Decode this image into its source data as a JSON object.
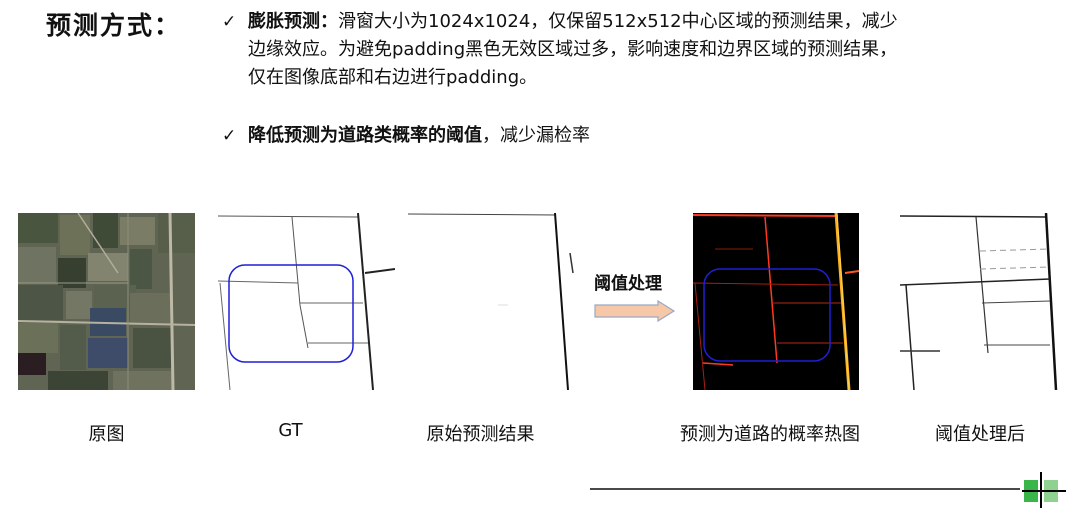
{
  "heading": "预测方式：",
  "bullets": [
    {
      "check": "✓",
      "bold": "膨胀预测：",
      "lines": [
        "滑窗大小为1024x1024，仅保留512x512中心区域的预测结果，减少",
        "边缘效应。为避免padding黑色无效区域过多，影响速度和边界区域的预测结果，",
        "仅在图像底部和右边进行padding。"
      ]
    },
    {
      "check": "✓",
      "bold": "降低预测为道路类概率的阈值",
      "rest": "，减少漏检率"
    }
  ],
  "arrow_label": "阈值处理",
  "captions": [
    "原图",
    "GT",
    "原始预测结果",
    "预测为道路的概率热图",
    "阈值处理后"
  ],
  "colors": {
    "roi_box": "#1f1fd6",
    "arrow_fill": "#f6c8a8",
    "arrow_stroke": "#9aa9c4",
    "heat_road": "#ff3a1e",
    "heat_bright": "#ffd34d"
  }
}
